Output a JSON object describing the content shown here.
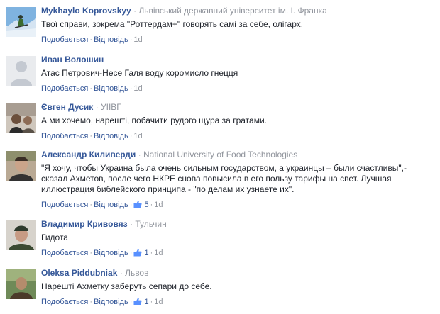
{
  "actions": {
    "like": "Подобається",
    "reply": "Відповідь",
    "dot": "·"
  },
  "comments": [
    {
      "author": "Mykhaylo Koprovskyy",
      "affiliation": "Львівський державний університет ім. І. Франка",
      "text": "Твої справи, зокрема \"Роттердам+\" говорять самі за себе, олігарх.",
      "time": "1d"
    },
    {
      "author": "Иван Волошин",
      "text": "Атас Петрович-Несе Галя воду коромисло гнецця",
      "time": "1d"
    },
    {
      "author": "Євген Дусик",
      "affiliation": "УІІВГ",
      "text": "А ми хочемо, нарешті, побачити рудого щура за гратами.",
      "time": "1d"
    },
    {
      "author": "Александр Киливерди",
      "affiliation": "National University of Food Technologies",
      "text_lines": [
        "\"Я хочу, чтобы Украина была очень сильным государством, а украинцы – были счастливы\",-",
        "сказал Ахметов, после чего НКРЕ снова повысила в его пользу тарифы на свет. Лучшая",
        "иллюстрация библейского принципа - \"по делам их узнаете их\"."
      ],
      "likes": "5",
      "time": "1d"
    },
    {
      "author": "Владимир Кривовяз",
      "affiliation": "Тульчин",
      "text": "Гидота",
      "likes": "1",
      "time": "1d"
    },
    {
      "author": "Oleksa Piddubniak",
      "affiliation": "Львов",
      "text": "Нарешті Ахметку заберуть сепари до себе.",
      "likes": "1",
      "time": "1d"
    }
  ],
  "colors": {
    "link": "#365899",
    "meta": "#90949c",
    "text": "#1d2129"
  }
}
